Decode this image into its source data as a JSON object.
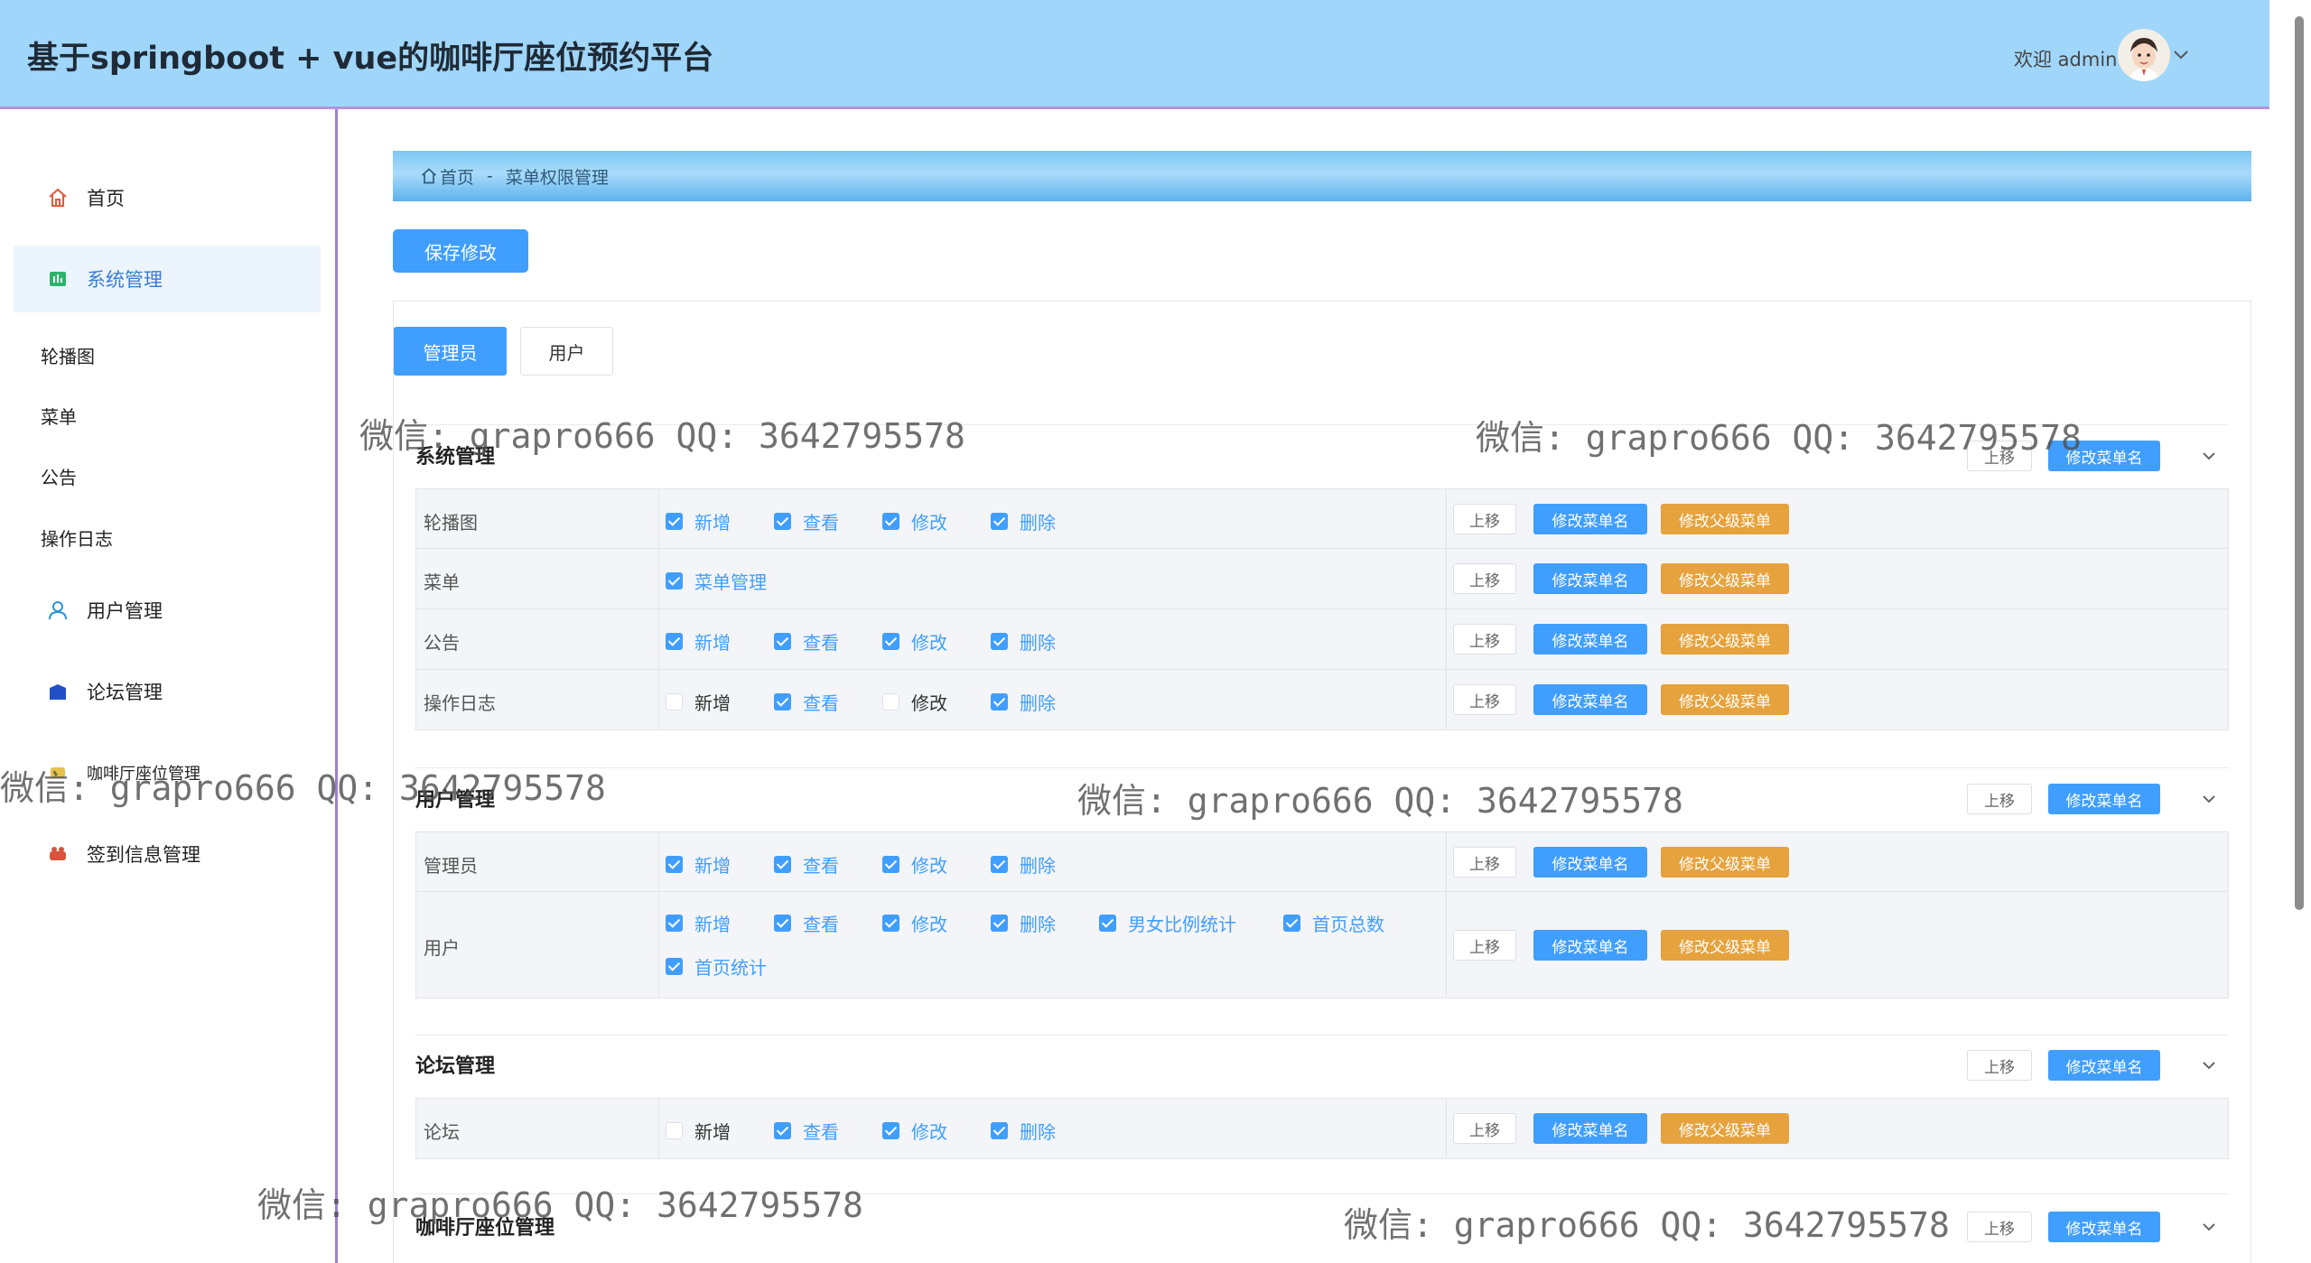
{
  "header": {
    "title": "基于springboot + vue的咖啡厅座位预约平台",
    "welcome": "欢迎 admin"
  },
  "sidebar": {
    "items": [
      {
        "label": "首页",
        "icon": "home-icon",
        "active": false
      },
      {
        "label": "系统管理",
        "icon": "system-icon",
        "active": true
      },
      {
        "label": "用户管理",
        "icon": "user-icon",
        "active": false
      },
      {
        "label": "论坛管理",
        "icon": "forum-icon",
        "active": false
      },
      {
        "label": "咖啡厅座位管理",
        "icon": "seat-icon",
        "active": false
      },
      {
        "label": "签到信息管理",
        "icon": "checkin-icon",
        "active": false
      }
    ],
    "sub_items": [
      "轮播图",
      "菜单",
      "公告",
      "操作日志"
    ]
  },
  "breadcrumb": {
    "home": "首页",
    "sep": "-",
    "current": "菜单权限管理"
  },
  "toolbar": {
    "save_label": "保存修改"
  },
  "tabs": [
    {
      "label": "管理员",
      "active": true
    },
    {
      "label": "用户",
      "active": false
    }
  ],
  "labels": {
    "up": "上移",
    "rename": "修改菜单名",
    "rename_parent": "修改父级菜单"
  },
  "groups": [
    {
      "title": "系统管理",
      "rows": [
        {
          "name": "轮播图",
          "perms": [
            {
              "label": "新增",
              "checked": true
            },
            {
              "label": "查看",
              "checked": true
            },
            {
              "label": "修改",
              "checked": true
            },
            {
              "label": "删除",
              "checked": true
            }
          ]
        },
        {
          "name": "菜单",
          "perms": [
            {
              "label": "菜单管理",
              "checked": true
            }
          ]
        },
        {
          "name": "公告",
          "perms": [
            {
              "label": "新增",
              "checked": true
            },
            {
              "label": "查看",
              "checked": true
            },
            {
              "label": "修改",
              "checked": true
            },
            {
              "label": "删除",
              "checked": true
            }
          ]
        },
        {
          "name": "操作日志",
          "perms": [
            {
              "label": "新增",
              "checked": false
            },
            {
              "label": "查看",
              "checked": true
            },
            {
              "label": "修改",
              "checked": false
            },
            {
              "label": "删除",
              "checked": true
            }
          ]
        }
      ]
    },
    {
      "title": "用户管理",
      "rows": [
        {
          "name": "管理员",
          "perms": [
            {
              "label": "新增",
              "checked": true
            },
            {
              "label": "查看",
              "checked": true
            },
            {
              "label": "修改",
              "checked": true
            },
            {
              "label": "删除",
              "checked": true
            }
          ]
        },
        {
          "name": "用户",
          "perms": [
            {
              "label": "新增",
              "checked": true
            },
            {
              "label": "查看",
              "checked": true
            },
            {
              "label": "修改",
              "checked": true
            },
            {
              "label": "删除",
              "checked": true
            },
            {
              "label": "男女比例统计",
              "checked": true
            },
            {
              "label": "首页总数",
              "checked": true
            },
            {
              "label": "首页统计",
              "checked": true
            }
          ]
        }
      ]
    },
    {
      "title": "论坛管理",
      "rows": [
        {
          "name": "论坛",
          "perms": [
            {
              "label": "新增",
              "checked": false
            },
            {
              "label": "查看",
              "checked": true
            },
            {
              "label": "修改",
              "checked": true
            },
            {
              "label": "删除",
              "checked": true
            }
          ]
        }
      ]
    },
    {
      "title": "咖啡厅座位管理",
      "rows": []
    }
  ],
  "watermark": "微信: grapro666 QQ: 3642795578"
}
